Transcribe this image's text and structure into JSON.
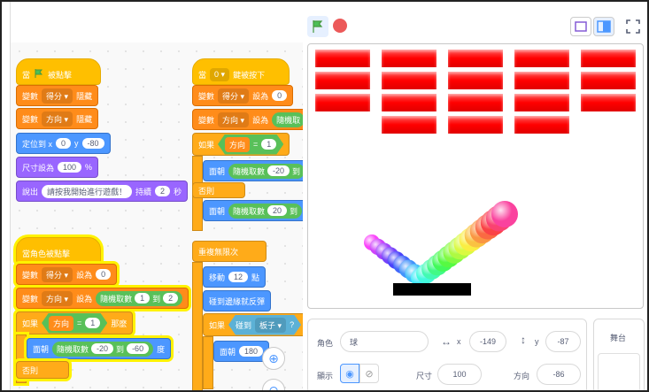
{
  "scripts": {
    "flag_script": {
      "hat": {
        "prefix": "當",
        "suffix": "被點擊"
      },
      "hide_score": {
        "verb": "變數",
        "var": "得分",
        "action": "隱藏"
      },
      "hide_dir": {
        "verb": "變數",
        "var": "方向",
        "action": "隱藏"
      },
      "goto": {
        "label": "定位到 x",
        "x": "0",
        "ylabel": "y",
        "y": "-80"
      },
      "size": {
        "label": "尺寸設為",
        "value": "100",
        "unit": "%"
      },
      "say": {
        "label": "說出",
        "text": "請按我開始進行遊戲！",
        "wait": "持續",
        "secs": "2",
        "unit": "秒"
      }
    },
    "clicked_script": {
      "hat": "當角色被點擊",
      "set_score": {
        "verb": "變數",
        "var": "得分",
        "to": "設為",
        "value": "0"
      },
      "set_dir": {
        "verb": "變數",
        "var": "方向",
        "to": "設為",
        "rand": "隨機取數",
        "from": "1",
        "and": "到",
        "upto": "2"
      },
      "if": {
        "label": "如果",
        "var": "方向",
        "eq": "=",
        "value": "1",
        "then": "那麼"
      },
      "turn": {
        "label": "面朝",
        "rand": "隨機取數",
        "from": "-20",
        "and": "到",
        "upto": "-60",
        "unit": "度"
      },
      "else": "否則"
    },
    "key_script": {
      "hat": {
        "prefix": "當",
        "key": "0",
        "suffix": "鍵被按下"
      },
      "set_score": {
        "verb": "變數",
        "var": "得分",
        "to": "設為",
        "value": "0"
      },
      "set_dir": {
        "verb": "變數",
        "var": "方向",
        "to": "設為",
        "rand": "隨機取"
      },
      "if": {
        "label": "如果",
        "var": "方向",
        "eq": "=",
        "value": "1"
      },
      "turn1": {
        "label": "面朝",
        "rand": "隨機取數",
        "from": "-20",
        "and": "到"
      },
      "else": "否則",
      "turn2": {
        "label": "面朝",
        "rand": "隨機取數",
        "from": "20",
        "and": "到"
      },
      "forever": "重複無限次",
      "move": {
        "label": "移動",
        "value": "12",
        "unit": "點"
      },
      "bounce": "碰到邊緣就反彈",
      "if_touch": {
        "label": "如果",
        "touch": "碰到",
        "target": "板子",
        "q": "?"
      },
      "turn3": {
        "label": "面朝",
        "value": "180"
      }
    }
  },
  "zoom": {
    "in_icon": "zoom-in-icon",
    "out_icon": "zoom-out-icon"
  },
  "stage": {
    "brick_color": "#ff1a1a",
    "bricks": [
      [
        1,
        1,
        1,
        1,
        1
      ],
      [
        1,
        1,
        1,
        1,
        1
      ],
      [
        1,
        1,
        1,
        1,
        1
      ],
      [
        0,
        1,
        1,
        1,
        0
      ]
    ]
  },
  "sprite": {
    "name_label": "角色",
    "name": "球",
    "x_label": "x",
    "x": "-149",
    "y_label": "y",
    "y": "-87",
    "show_label": "顯示",
    "size_label": "尺寸",
    "size": "100",
    "dir_label": "方向",
    "dir": "-86"
  },
  "stage_pane": {
    "label": "舞台"
  }
}
